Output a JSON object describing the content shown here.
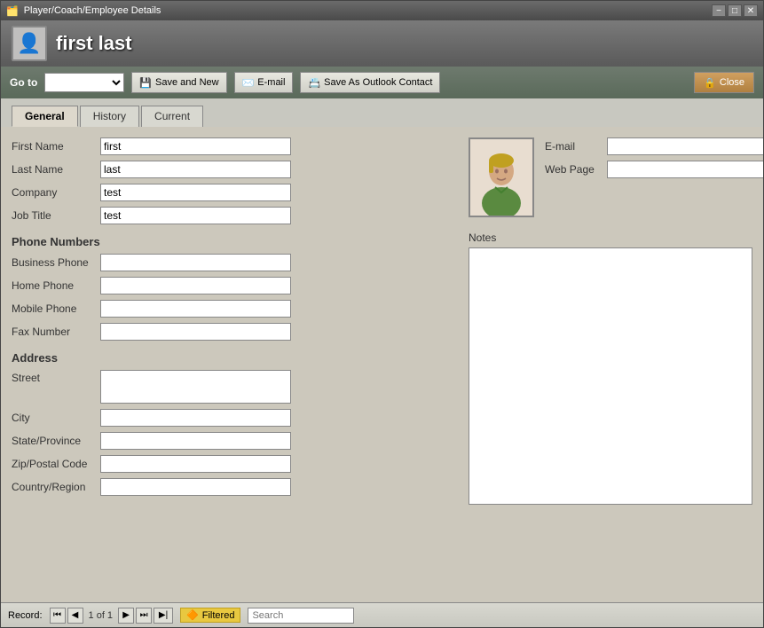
{
  "window": {
    "title": "Player/Coach/Employee Details",
    "min_label": "−",
    "max_label": "□",
    "close_label": "✕"
  },
  "header": {
    "title": "first last",
    "icon_label": "👤"
  },
  "toolbar": {
    "goto_label": "Go to",
    "goto_placeholder": "",
    "save_new_label": "Save and New",
    "email_label": "E-mail",
    "outlook_label": "Save As Outlook Contact",
    "close_label": "Close"
  },
  "tabs": [
    {
      "id": "general",
      "label": "General",
      "active": true
    },
    {
      "id": "history",
      "label": "History",
      "active": false
    },
    {
      "id": "current",
      "label": "Current",
      "active": false
    }
  ],
  "form": {
    "first_name_label": "First Name",
    "first_name_value": "first",
    "last_name_label": "Last Name",
    "last_name_value": "last",
    "company_label": "Company",
    "company_value": "test",
    "job_title_label": "Job Title",
    "job_title_value": "test",
    "email_label": "E-mail",
    "email_value": "",
    "web_page_label": "Web Page",
    "web_page_value": "",
    "phone_section_title": "Phone Numbers",
    "business_phone_label": "Business Phone",
    "business_phone_value": "",
    "home_phone_label": "Home Phone",
    "home_phone_value": "",
    "mobile_phone_label": "Mobile Phone",
    "mobile_phone_value": "",
    "fax_number_label": "Fax Number",
    "fax_number_value": "",
    "address_section_title": "Address",
    "street_label": "Street",
    "street_value": "",
    "city_label": "City",
    "city_value": "",
    "state_label": "State/Province",
    "state_value": "",
    "zip_label": "Zip/Postal Code",
    "zip_value": "",
    "country_label": "Country/Region",
    "country_value": "",
    "notes_label": "Notes"
  },
  "status_bar": {
    "record_label": "Record:",
    "first_icon": "⏮",
    "prev_icon": "◀",
    "record_info": "1 of 1",
    "next_icon": "▶",
    "last_icon": "⏭",
    "add_icon": "▶|",
    "filtered_icon": "🔶",
    "filtered_label": "Filtered",
    "search_placeholder": "Search",
    "search_label": "Search"
  }
}
